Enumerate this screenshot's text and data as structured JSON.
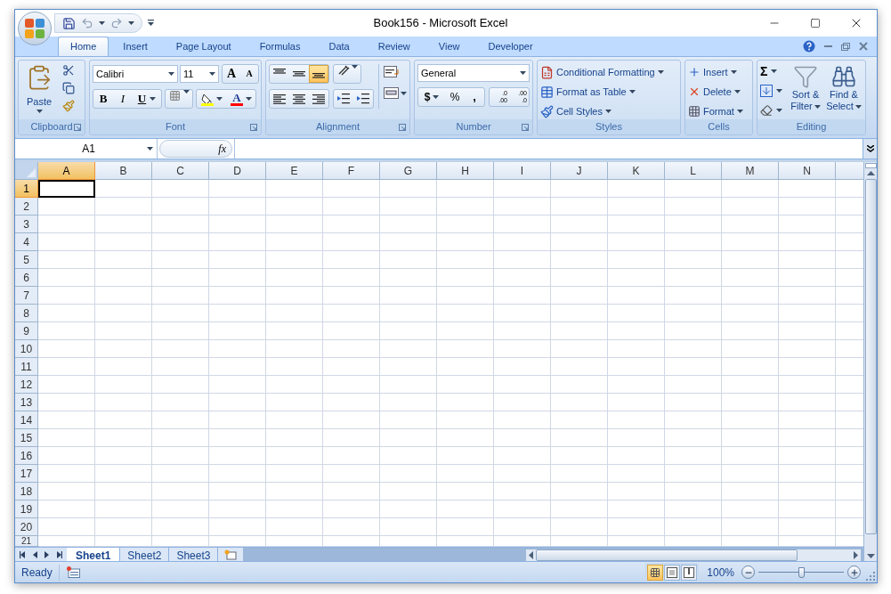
{
  "window": {
    "title": "Book156 - Microsoft Excel"
  },
  "tabs": [
    {
      "label": "Home",
      "selected": true
    },
    {
      "label": "Insert",
      "selected": false
    },
    {
      "label": "Page Layout",
      "selected": false
    },
    {
      "label": "Formulas",
      "selected": false
    },
    {
      "label": "Data",
      "selected": false
    },
    {
      "label": "Review",
      "selected": false
    },
    {
      "label": "View",
      "selected": false
    },
    {
      "label": "Developer",
      "selected": false
    }
  ],
  "ribbon": {
    "clipboard": {
      "label": "Clipboard",
      "paste": "Paste"
    },
    "font": {
      "label": "Font",
      "font_name": "Calibri",
      "font_size": "11",
      "grow": "A",
      "shrink": "A",
      "bold": "B",
      "italic": "I",
      "underline": "U",
      "font_color": "A"
    },
    "alignment": {
      "label": "Alignment",
      "vertical": [
        {
          "selected": false
        },
        {
          "selected": false
        },
        {
          "selected": true
        }
      ]
    },
    "number": {
      "label": "Number",
      "format": "General",
      "currency": "$",
      "percent": "%",
      "comma": ",",
      "increase_decimal": [
        ".0",
        ".00"
      ],
      "decrease_decimal": [
        ".00",
        ".0"
      ]
    },
    "styles": {
      "label": "Styles",
      "items": [
        "Conditional Formatting",
        "Format as Table",
        "Cell Styles"
      ]
    },
    "cells": {
      "label": "Cells",
      "items": [
        "Insert",
        "Delete",
        "Format"
      ]
    },
    "editing": {
      "label": "Editing",
      "autosum": "Σ",
      "sort": [
        "Sort &",
        "Filter"
      ],
      "find": [
        "Find &",
        "Select"
      ]
    }
  },
  "formula_bar": {
    "name_box": "A1",
    "function_label": "fx"
  },
  "columns": [
    {
      "label": "A",
      "selected": true
    },
    {
      "label": "B",
      "selected": false
    },
    {
      "label": "C",
      "selected": false
    },
    {
      "label": "D",
      "selected": false
    },
    {
      "label": "E",
      "selected": false
    },
    {
      "label": "F",
      "selected": false
    },
    {
      "label": "G",
      "selected": false
    },
    {
      "label": "H",
      "selected": false
    },
    {
      "label": "I",
      "selected": false
    },
    {
      "label": "J",
      "selected": false
    },
    {
      "label": "K",
      "selected": false
    },
    {
      "label": "L",
      "selected": false
    },
    {
      "label": "M",
      "selected": false
    },
    {
      "label": "N",
      "selected": false
    }
  ],
  "rows": [
    {
      "label": "1",
      "selected": true
    },
    {
      "label": "2",
      "selected": false
    },
    {
      "label": "3",
      "selected": false
    },
    {
      "label": "4",
      "selected": false
    },
    {
      "label": "5",
      "selected": false
    },
    {
      "label": "6",
      "selected": false
    },
    {
      "label": "7",
      "selected": false
    },
    {
      "label": "8",
      "selected": false
    },
    {
      "label": "9",
      "selected": false
    },
    {
      "label": "10",
      "selected": false
    },
    {
      "label": "11",
      "selected": false
    },
    {
      "label": "12",
      "selected": false
    },
    {
      "label": "13",
      "selected": false
    },
    {
      "label": "14",
      "selected": false
    },
    {
      "label": "15",
      "selected": false
    },
    {
      "label": "16",
      "selected": false
    },
    {
      "label": "17",
      "selected": false
    },
    {
      "label": "18",
      "selected": false
    },
    {
      "label": "19",
      "selected": false
    },
    {
      "label": "20",
      "selected": false
    },
    {
      "label": "21",
      "selected": false
    }
  ],
  "sheet_tabs": [
    {
      "label": "Sheet1",
      "selected": true
    },
    {
      "label": "Sheet2",
      "selected": false
    },
    {
      "label": "Sheet3",
      "selected": false
    }
  ],
  "status_bar": {
    "text": "Ready",
    "view_buttons": [
      {
        "selected": true
      },
      {
        "selected": false
      },
      {
        "selected": false
      }
    ],
    "zoom": {
      "reading": "100%",
      "level": 0.5
    }
  }
}
